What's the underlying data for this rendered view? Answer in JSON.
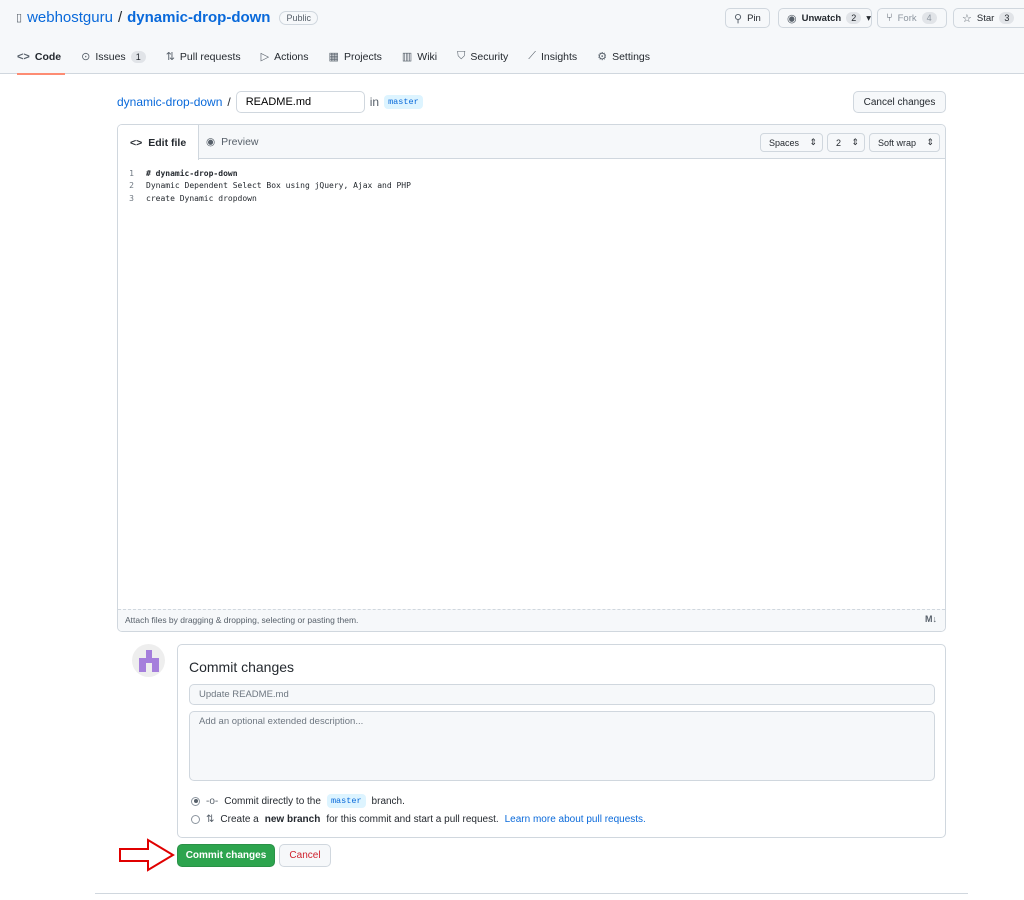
{
  "header": {
    "owner": "webhostguru",
    "separator": "/",
    "repo": "dynamic-drop-down",
    "visibility": "Public",
    "actions": [
      {
        "label": "Pin",
        "icon": "pin-icon"
      },
      {
        "label": "Unwatch",
        "count": "2",
        "icon": "eye-icon"
      },
      {
        "label": "Fork",
        "count": "4",
        "icon": "fork-icon"
      },
      {
        "label": "Star",
        "count": "3",
        "icon": "star-icon"
      }
    ],
    "tabs": [
      {
        "label": "Code",
        "icon": "code-icon",
        "selected": true
      },
      {
        "label": "Issues",
        "count": "1",
        "icon": "issue-icon"
      },
      {
        "label": "Pull requests",
        "icon": "pull-request-icon"
      },
      {
        "label": "Actions",
        "icon": "play-icon"
      },
      {
        "label": "Projects",
        "icon": "table-icon"
      },
      {
        "label": "Wiki",
        "icon": "book-icon"
      },
      {
        "label": "Security",
        "icon": "shield-icon"
      },
      {
        "label": "Insights",
        "icon": "graph-icon"
      },
      {
        "label": "Settings",
        "icon": "gear-icon"
      }
    ]
  },
  "path": {
    "repo_link": "dynamic-drop-down",
    "separator": "/",
    "filename": "README.md",
    "in": "in",
    "branch": "master",
    "cancel": "Cancel changes"
  },
  "editor": {
    "tab_edit": "Edit file",
    "tab_preview": "Preview",
    "indent_mode": "Spaces",
    "indent_size": "2",
    "wrap": "Soft wrap",
    "lines": [
      {
        "n": "1",
        "text": "# dynamic-drop-down"
      },
      {
        "n": "2",
        "text": "Dynamic Dependent Select Box using jQuery, Ajax and PHP"
      },
      {
        "n": "3",
        "text": "create Dynamic dropdown"
      }
    ],
    "footer": "Attach files by dragging & dropping, selecting or pasting them."
  },
  "commit": {
    "title": "Commit changes",
    "summary_placeholder": "Update README.md",
    "desc_placeholder": "Add an optional extended description...",
    "opt1_pre": "Commit directly to the",
    "opt1_branch": "master",
    "opt1_post": "branch.",
    "opt2_pre": "Create a",
    "opt2_bold": "new branch",
    "opt2_post": "for this commit and start a pull request.",
    "opt2_link": "Learn more about pull requests.",
    "submit": "Commit changes",
    "cancel": "Cancel"
  },
  "colors": {
    "primary": "#2da44e",
    "link": "#0969da",
    "tab_underline": "#fd8c73",
    "annotation_arrow": "#e00000"
  }
}
